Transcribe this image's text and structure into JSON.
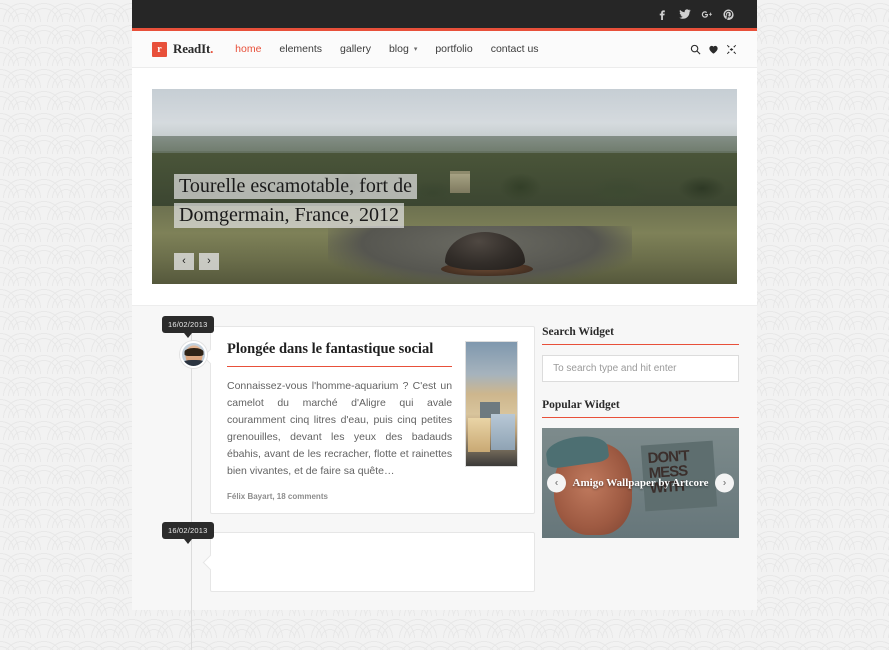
{
  "site": {
    "logo_mark": "r",
    "logo_text": "ReadIt",
    "logo_dot": "."
  },
  "topbar": {
    "social": [
      {
        "name": "facebook-icon",
        "glyph": "f"
      },
      {
        "name": "twitter-icon",
        "glyph": "t"
      },
      {
        "name": "google-plus-icon",
        "glyph": "g+"
      },
      {
        "name": "pinterest-icon",
        "glyph": "p"
      }
    ]
  },
  "nav": {
    "items": [
      {
        "label": "home",
        "active": true
      },
      {
        "label": "elements",
        "active": false
      },
      {
        "label": "gallery",
        "active": false
      },
      {
        "label": "blog",
        "active": false,
        "caret": "▾"
      },
      {
        "label": "portfolio",
        "active": false
      },
      {
        "label": "contact us",
        "active": false
      }
    ],
    "tools": [
      {
        "name": "search-icon"
      },
      {
        "name": "heart-icon"
      },
      {
        "name": "expand-icon"
      }
    ]
  },
  "hero": {
    "caption_line1": "Tourelle escamotable, fort de",
    "caption_line2": "Domgermain, France, 2012",
    "prev": "‹",
    "next": "›"
  },
  "posts": [
    {
      "date": "16/02/2013",
      "title": "Plongée dans le fantastique social",
      "text": "Connaissez-vous l'homme-aquarium ? C'est un camelot du marché d'Aligre qui avale couramment cinq litres d'eau, puis cinq petites grenouilles, devant les yeux des badauds ébahis, avant de les recracher, flotte et rainettes bien vivantes, et de faire sa quête…",
      "meta": "Félix Bayart, 18 comments"
    },
    {
      "date": "16/02/2013",
      "title": "",
      "text": "",
      "meta": ""
    }
  ],
  "sidebar": {
    "search_widget": {
      "title": "Search Widget",
      "placeholder": "To search type and hit enter",
      "value": ""
    },
    "popular_widget": {
      "title": "Popular Widget",
      "caption": "Amigo Wallpaper by Artcore",
      "sign_text": "DON'T MESS WITH",
      "prev": "‹",
      "next": "›"
    }
  },
  "colors": {
    "accent": "#e8503a",
    "topbar_bg": "#262626",
    "nav_bg": "#fbfbfb",
    "page_bg": "#f2f2f2",
    "content_bg": "#f7f7f7"
  }
}
